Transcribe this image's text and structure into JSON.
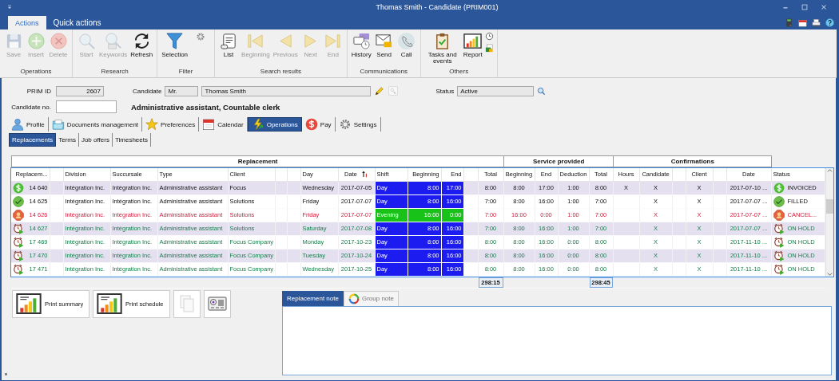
{
  "window": {
    "title": "Thomas Smith - Candidate (PRIM001)"
  },
  "ribbon_tabs": [
    {
      "label": "Actions",
      "selected": true
    },
    {
      "label": "Quick actions",
      "selected": false
    }
  ],
  "ribbon_groups": [
    {
      "label": "Operations",
      "buttons": [
        {
          "kind": "save",
          "label": "Save",
          "disabled": true
        },
        {
          "kind": "insert",
          "label": "Insert",
          "disabled": true
        },
        {
          "kind": "delete",
          "label": "Delete",
          "disabled": true
        }
      ]
    },
    {
      "label": "Research",
      "buttons": [
        {
          "kind": "start",
          "label": "Start",
          "disabled": true
        },
        {
          "kind": "keywords",
          "label": "Keywords",
          "disabled": true
        },
        {
          "kind": "refresh",
          "label": "Refresh",
          "disabled": false
        }
      ]
    },
    {
      "label": "Filter",
      "buttons": [
        {
          "kind": "selection",
          "label": "Selection",
          "disabled": false
        },
        {
          "kind": "gear",
          "disabled": false
        }
      ]
    },
    {
      "label": "Search results",
      "buttons": [
        {
          "kind": "list",
          "label": "List",
          "disabled": false
        },
        {
          "kind": "first",
          "label": "Beginning",
          "disabled": true
        },
        {
          "kind": "prev",
          "label": "Previous",
          "disabled": true
        },
        {
          "kind": "next",
          "label": "Next",
          "disabled": true
        },
        {
          "kind": "last",
          "label": "End",
          "disabled": true
        }
      ]
    },
    {
      "label": "Communications",
      "buttons": [
        {
          "kind": "history",
          "label": "History",
          "disabled": false
        },
        {
          "kind": "send",
          "label": "Send",
          "disabled": false
        },
        {
          "kind": "call",
          "label": "Call",
          "disabled": false
        }
      ]
    },
    {
      "label": "Others",
      "buttons": [
        {
          "kind": "tasks",
          "label": "Tasks and events",
          "disabled": false
        },
        {
          "kind": "report",
          "label": "Report",
          "disabled": false
        },
        {
          "kind": "small_pair",
          "disabled": false
        }
      ]
    }
  ],
  "form": {
    "prim_id_label": "PRIM ID",
    "prim_id": "2607",
    "candidate_label": "Candidate",
    "salutation": "Mr.",
    "candidate_name": "Thomas Smith",
    "status_label": "Status",
    "status": "Active",
    "candidate_no_label": "Candidate no.",
    "job_title": "Administrative assistant, Countable clerk"
  },
  "main_tabs": [
    {
      "kind": "profile",
      "label": "Profile",
      "selected": false
    },
    {
      "kind": "documents",
      "label": "Documents management",
      "selected": false
    },
    {
      "kind": "preferences",
      "label": "Preferences",
      "selected": false
    },
    {
      "kind": "calendar",
      "label": "Calendar",
      "selected": false
    },
    {
      "kind": "operations",
      "label": "Operations",
      "selected": true
    },
    {
      "kind": "pay",
      "label": "Pay",
      "selected": false
    },
    {
      "kind": "settings",
      "label": "Settings",
      "selected": false
    }
  ],
  "sub_tabs": [
    {
      "label": "Replacements",
      "selected": true
    },
    {
      "label": "Terms",
      "selected": false
    },
    {
      "label": "Job offers",
      "selected": false
    },
    {
      "label": "Timesheets",
      "selected": false
    }
  ],
  "table": {
    "column_groups": [
      "Replacement",
      "Service provided",
      "Confirmations"
    ],
    "columns": [
      "Replacem...",
      "Division",
      "Succursale",
      "Type",
      "Client",
      "Day",
      "Date",
      "Shift",
      "Beginning",
      "End",
      "Total",
      "Beginning",
      "End",
      "Deduction",
      "Total",
      "Hours",
      "Candidate",
      "Client",
      "Date",
      "Status"
    ],
    "rows": [
      {
        "kind": "invoiced",
        "highlighted": true,
        "id": "14 640",
        "division": "Intégration Inc.",
        "branch": "Intégration Inc.",
        "type": "Administrative assistant",
        "client": "Focus",
        "day": "Wednesday",
        "date": "2017-07-05",
        "shift": {
          "kind": "day",
          "label": "Day"
        },
        "start": "8:00",
        "end": "17:00",
        "total": "8:00",
        "sp_start": "8:00",
        "sp_end": "17:00",
        "deduction": "1:00",
        "sp_total": "8:00",
        "hours": "X",
        "candidate": "X",
        "client_conf": "X",
        "conf_date": "2017-07-10 ...",
        "status": "INVOICED"
      },
      {
        "kind": "filled",
        "highlighted": false,
        "id": "14 625",
        "division": "Intégration Inc.",
        "branch": "Intégration Inc.",
        "type": "Administrative assistant",
        "client": "Solutions",
        "day": "Friday",
        "date": "2017-07-07",
        "shift": {
          "kind": "day",
          "label": "Day"
        },
        "start": "8:00",
        "end": "16:00",
        "total": "7:00",
        "sp_start": "8:00",
        "sp_end": "16:00",
        "deduction": "1:00",
        "sp_total": "7:00",
        "candidate": "X",
        "client_conf": "X",
        "conf_date": "2017-07-07 ...",
        "status": "FILLED"
      },
      {
        "kind": "canceled",
        "highlighted": false,
        "id": "14 626",
        "division": "Intégration Inc.",
        "branch": "Intégration Inc.",
        "type": "Administrative assistant",
        "client": "Solutions",
        "day": "Friday",
        "date": "2017-07-07",
        "shift": {
          "kind": "evening",
          "label": "Evening"
        },
        "start": "16:00",
        "end": "0:00",
        "total": "7:00",
        "sp_start": "16:00",
        "sp_end": "0:00",
        "deduction": "1:00",
        "sp_total": "7:00",
        "candidate": "X",
        "client_conf": "X",
        "conf_date": "2017-07-07 ...",
        "status": "CANCEL..."
      },
      {
        "kind": "on_hold",
        "highlighted": true,
        "id": "14 627",
        "division": "Intégration Inc.",
        "branch": "Intégration Inc.",
        "type": "Administrative assistant",
        "client": "Solutions",
        "day": "Saturday",
        "date": "2017-07-08",
        "shift": {
          "kind": "day",
          "label": "Day"
        },
        "start": "8:00",
        "end": "16:00",
        "total": "7:00",
        "sp_start": "8:00",
        "sp_end": "16:00",
        "deduction": "1:00",
        "sp_total": "7:00",
        "candidate": "X",
        "client_conf": "X",
        "conf_date": "2017-07-07 ...",
        "status": "ON HOLD"
      },
      {
        "kind": "on_hold",
        "highlighted": false,
        "id": "17 469",
        "division": "Intégration Inc.",
        "branch": "Intégration Inc.",
        "type": "Administrative assistant",
        "client": "Focus Company",
        "day": "Monday",
        "date": "2017-10-23",
        "shift": {
          "kind": "day",
          "label": "Day"
        },
        "start": "8:00",
        "end": "16:00",
        "total": "8:00",
        "sp_start": "8:00",
        "sp_end": "16:00",
        "deduction": "0:00",
        "sp_total": "8:00",
        "candidate": "X",
        "client_conf": "X",
        "conf_date": "2017-11-10 ...",
        "status": "ON HOLD"
      },
      {
        "kind": "on_hold",
        "highlighted": true,
        "id": "17 470",
        "division": "Intégration Inc.",
        "branch": "Intégration Inc.",
        "type": "Administrative assistant",
        "client": "Focus Company",
        "day": "Tuesday",
        "date": "2017-10-24",
        "shift": {
          "kind": "day",
          "label": "Day"
        },
        "start": "8:00",
        "end": "16:00",
        "total": "8:00",
        "sp_start": "8:00",
        "sp_end": "16:00",
        "deduction": "0:00",
        "sp_total": "8:00",
        "candidate": "X",
        "client_conf": "X",
        "conf_date": "2017-11-10 ...",
        "status": "ON HOLD"
      },
      {
        "kind": "on_hold",
        "highlighted": false,
        "id": "17 471",
        "division": "Intégration Inc.",
        "branch": "Intégration Inc.",
        "type": "Administrative assistant",
        "client": "Focus Company",
        "day": "Wednesday",
        "date": "2017-10-25",
        "shift": {
          "kind": "day",
          "label": "Day"
        },
        "start": "8:00",
        "end": "16:00",
        "total": "8:00",
        "sp_start": "8:00",
        "sp_end": "16:00",
        "deduction": "0:00",
        "sp_total": "8:00",
        "candidate": "X",
        "client_conf": "X",
        "conf_date": "2017-11-10 ...",
        "status": "ON HOLD"
      }
    ],
    "totals": [
      "298:15",
      "298:45"
    ]
  },
  "print_buttons": [
    {
      "kind": "summary",
      "label": "Print summary",
      "disabled": false
    },
    {
      "kind": "schedule",
      "label": "Print schedule",
      "disabled": false
    },
    {
      "kind": "copy",
      "disabled": true
    },
    {
      "kind": "card",
      "disabled": false
    }
  ],
  "note_tabs": [
    {
      "kind": "plain",
      "label": "Replacement note",
      "selected": true
    },
    {
      "kind": "group",
      "label": "Group note",
      "selected": false
    }
  ]
}
